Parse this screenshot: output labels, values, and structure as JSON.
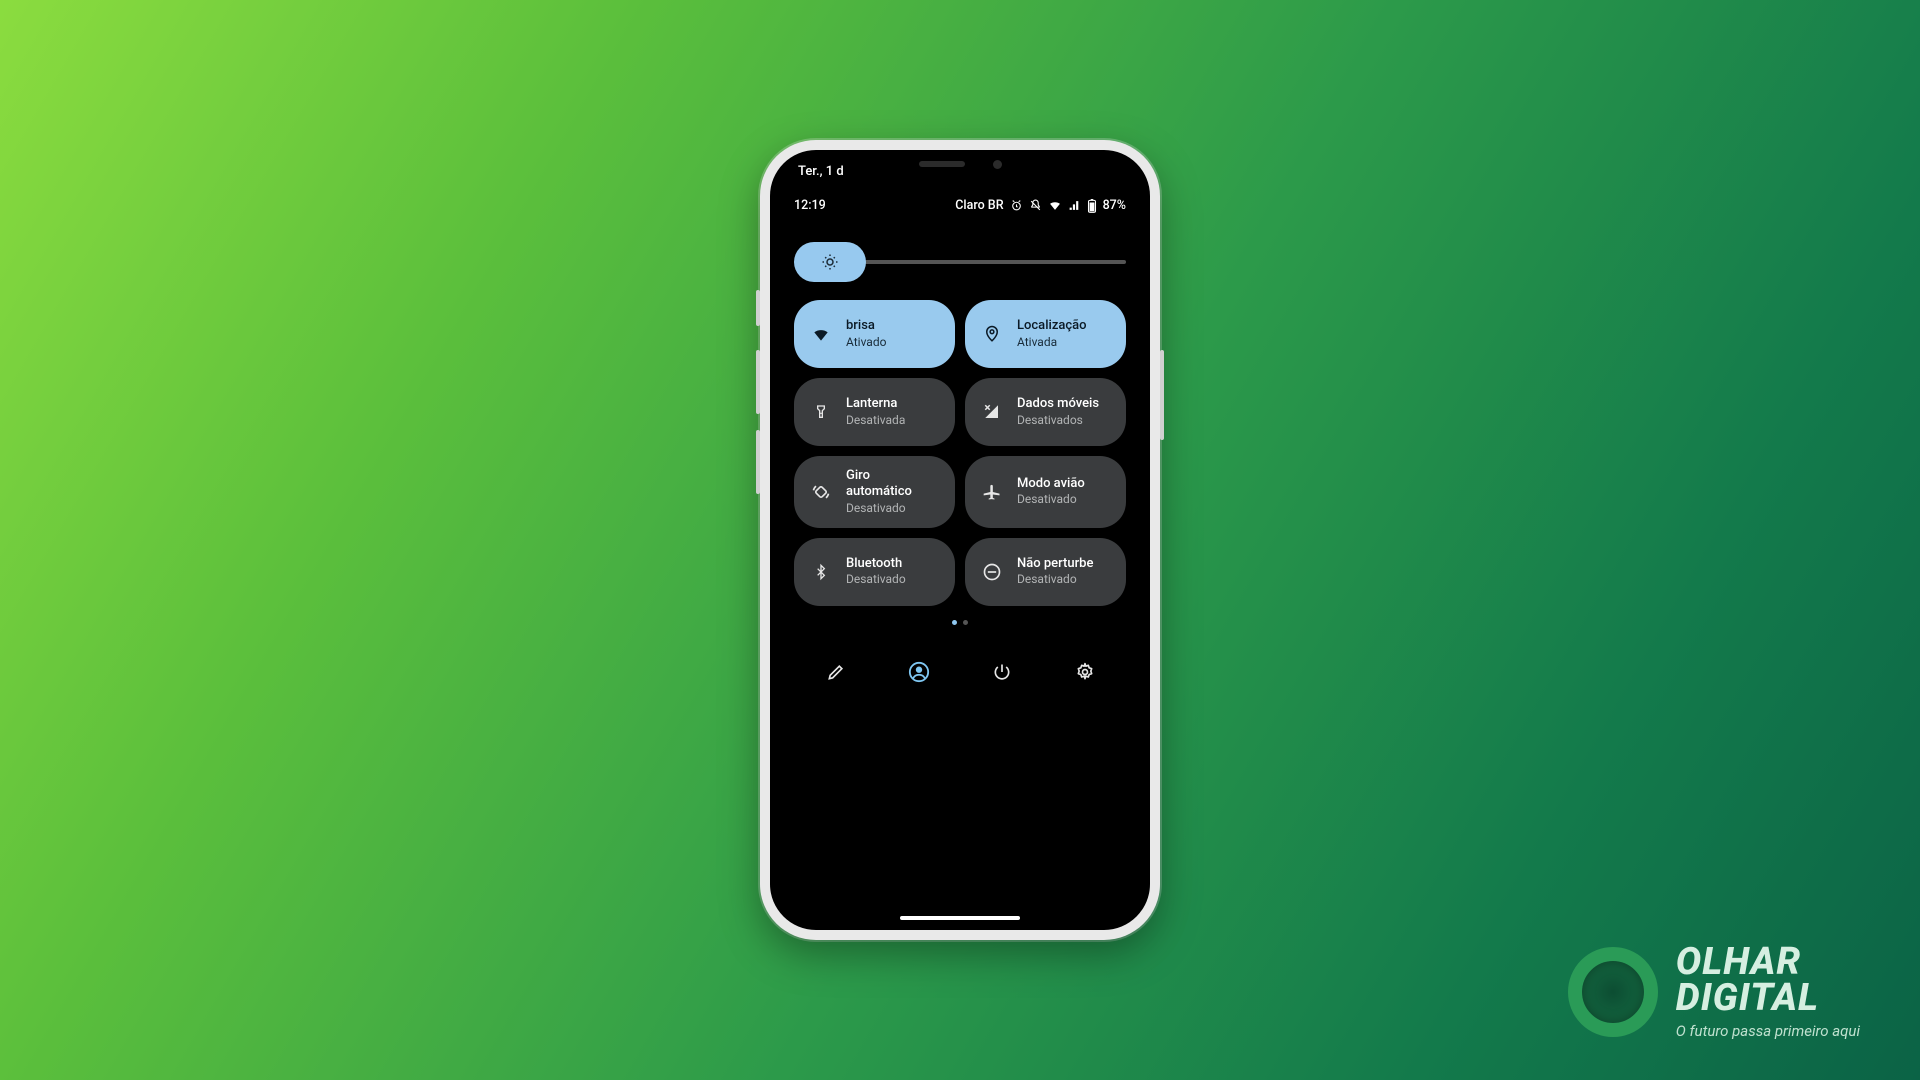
{
  "status": {
    "date": "Ter., 1 d",
    "time": "12:19",
    "carrier": "Claro BR",
    "battery_pct": "87%"
  },
  "tiles": [
    {
      "id": "wifi",
      "title": "brisa",
      "status": "Ativado",
      "active": true
    },
    {
      "id": "location",
      "title": "Localização",
      "status": "Ativada",
      "active": true
    },
    {
      "id": "flashlight",
      "title": "Lanterna",
      "status": "Desativada",
      "active": false
    },
    {
      "id": "mobiledata",
      "title": "Dados móveis",
      "status": "Desativados",
      "active": false
    },
    {
      "id": "autorotate",
      "title": "Giro automático",
      "status": "Desativado",
      "active": false
    },
    {
      "id": "airplane",
      "title": "Modo avião",
      "status": "Desativado",
      "active": false
    },
    {
      "id": "bluetooth",
      "title": "Bluetooth",
      "status": "Desativado",
      "active": false
    },
    {
      "id": "dnd",
      "title": "Não perturbe",
      "status": "Desativado",
      "active": false
    }
  ],
  "brand": {
    "line1a": "OLHAR",
    "line1b": "DIGITAL",
    "tag": "O futuro passa primeiro aqui"
  }
}
